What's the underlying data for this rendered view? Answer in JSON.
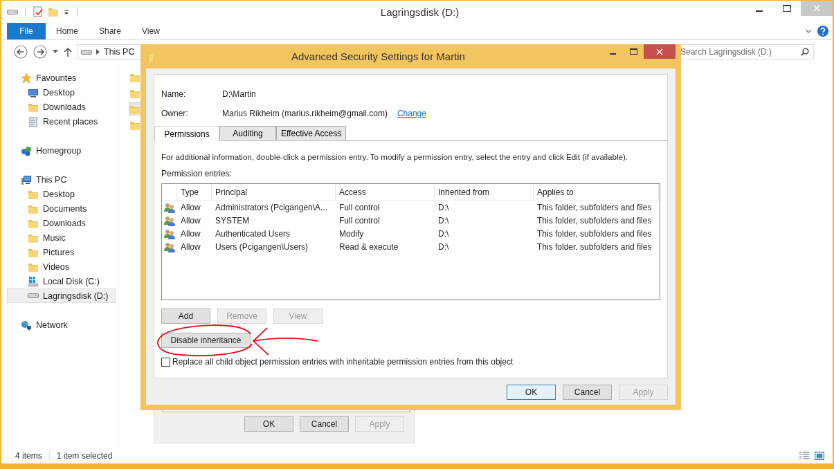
{
  "window": {
    "title": "Lagringsdisk (D:)"
  },
  "ribbon": {
    "tabs": [
      {
        "label": "File",
        "kind": "file"
      },
      {
        "label": "Home",
        "kind": "tab"
      },
      {
        "label": "Share",
        "kind": "tab"
      },
      {
        "label": "View",
        "kind": "tab"
      }
    ]
  },
  "address_bar": {
    "path": "This PC"
  },
  "search": {
    "placeholder": "Search Lagringsdisk (D:)"
  },
  "navigation": [
    {
      "label": "Favourites",
      "kind": "star",
      "selected": false,
      "children": [
        {
          "label": "Desktop",
          "kind": "monitor",
          "selected": false
        },
        {
          "label": "Downloads",
          "kind": "folder",
          "selected": false
        },
        {
          "label": "Recent places",
          "kind": "recent",
          "selected": false
        }
      ]
    },
    {
      "label": "Homegroup",
      "kind": "homegroup",
      "selected": false
    },
    {
      "label": "This PC",
      "kind": "pc",
      "selected": false,
      "children": [
        {
          "label": "Desktop",
          "kind": "folder",
          "selected": false
        },
        {
          "label": "Documents",
          "kind": "folder",
          "selected": false
        },
        {
          "label": "Downloads",
          "kind": "folder",
          "selected": false
        },
        {
          "label": "Music",
          "kind": "folder",
          "selected": false
        },
        {
          "label": "Pictures",
          "kind": "folder",
          "selected": false
        },
        {
          "label": "Videos",
          "kind": "folder",
          "selected": false
        },
        {
          "label": "Local Disk (C:)",
          "kind": "system-drive",
          "selected": false
        },
        {
          "label": "Lagringsdisk (D:)",
          "kind": "drive",
          "selected": true
        }
      ]
    },
    {
      "label": "Network",
      "kind": "network",
      "selected": false
    }
  ],
  "content": {
    "items": [
      {
        "kind": "folder",
        "selected": false
      },
      {
        "kind": "folder",
        "selected": false
      },
      {
        "kind": "folder",
        "selected": true
      },
      {
        "kind": "folder",
        "selected": false
      }
    ]
  },
  "status_bar": {
    "item_count": "4 items",
    "selection": "1 item selected"
  },
  "properties_dialog": {
    "buttons": [
      {
        "label": "OK",
        "disabled": false
      },
      {
        "label": "Cancel",
        "disabled": false
      },
      {
        "label": "Apply",
        "disabled": true
      }
    ]
  },
  "dialog": {
    "title": "Advanced Security Settings for Martin",
    "name_label": "Name:",
    "name_value": "D:\\Martin",
    "owner_label": "Owner:",
    "owner_value": "Marius Rikheim (marius.rikheim@gmail.com)",
    "change_link": "Change",
    "tabs": [
      {
        "label": "Permissions",
        "selected": true
      },
      {
        "label": "Auditing",
        "selected": false
      },
      {
        "label": "Effective Access",
        "selected": false
      }
    ],
    "info": "For additional information, double-click a permission entry. To modify a permission entry, select the entry and click Edit (if available).",
    "entries_label": "Permission entries:",
    "table": {
      "columns": [
        "Type",
        "Principal",
        "Access",
        "Inherited from",
        "Applies to"
      ],
      "rows": [
        [
          "Allow",
          "Administrators (Pcigangen\\A...",
          "Full control",
          "D:\\",
          "This folder, subfolders and files"
        ],
        [
          "Allow",
          "SYSTEM",
          "Full control",
          "D:\\",
          "This folder, subfolders and files"
        ],
        [
          "Allow",
          "Authenticated Users",
          "Modify",
          "D:\\",
          "This folder, subfolders and files"
        ],
        [
          "Allow",
          "Users (Pcigangen\\Users)",
          "Read & execute",
          "D:\\",
          "This folder, subfolders and files"
        ]
      ]
    },
    "actions": [
      {
        "label": "Add",
        "disabled": false
      },
      {
        "label": "Remove",
        "disabled": true
      },
      {
        "label": "View",
        "disabled": true
      }
    ],
    "inheritance_button": "Disable inheritance",
    "replace_checkbox": {
      "label": "Replace all child object permission entries with inheritable permission entries from this object",
      "checked": false
    },
    "buttons": [
      {
        "label": "OK",
        "disabled": false,
        "default": true
      },
      {
        "label": "Cancel",
        "disabled": false,
        "default": false
      },
      {
        "label": "Apply",
        "disabled": true,
        "default": false
      }
    ]
  },
  "annotation": {
    "kind": "circle-with-arrow"
  }
}
